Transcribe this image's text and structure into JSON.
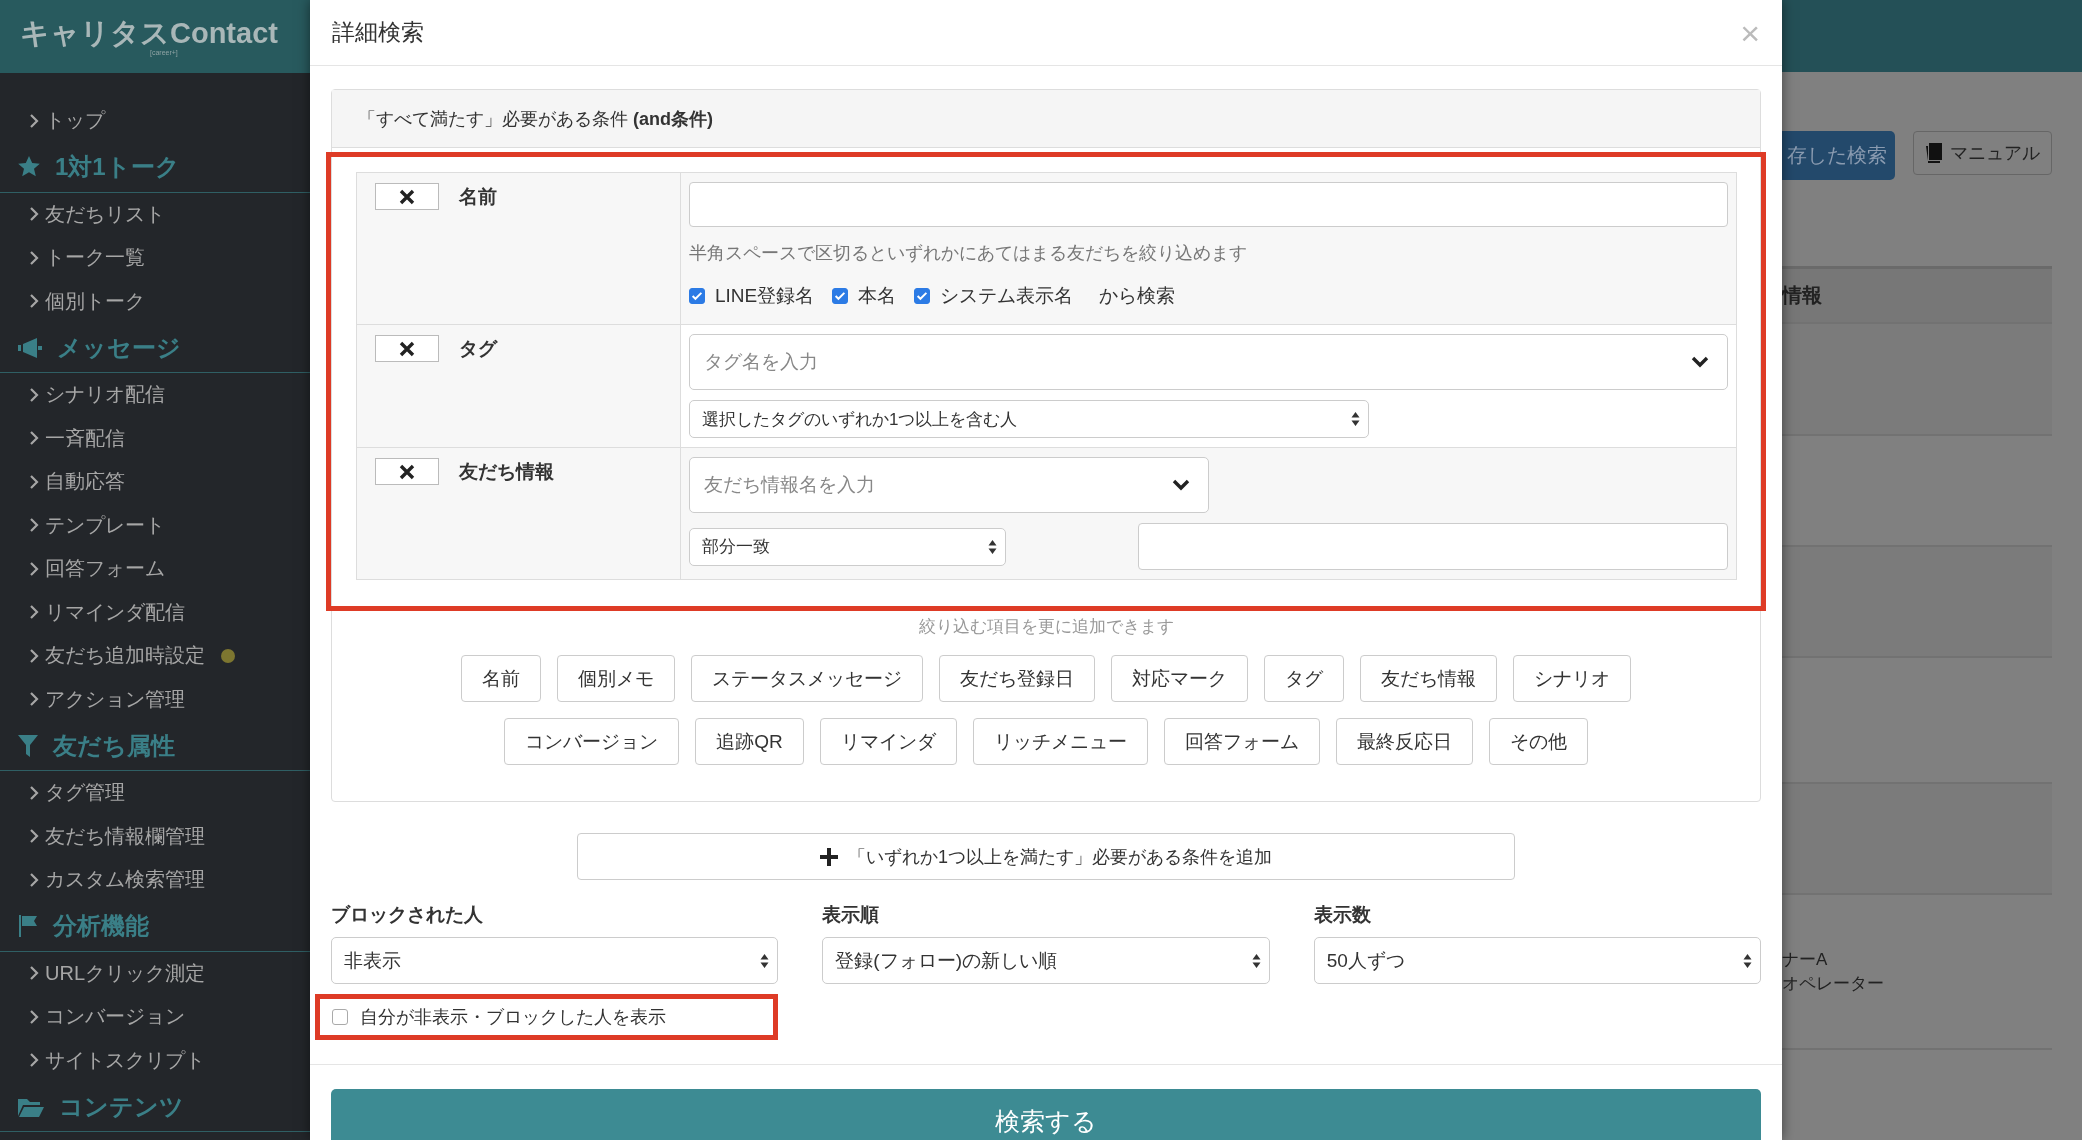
{
  "sidebar": {
    "logo": "キャリタスContact",
    "logo_sub": "[career+]",
    "top_items": [
      {
        "label": "トップ",
        "notice": false
      }
    ],
    "sections": [
      {
        "title": "1対1トーク",
        "items": [
          {
            "label": "友だちリスト",
            "notice": false
          },
          {
            "label": "トーク一覧",
            "notice": false
          },
          {
            "label": "個別トーク",
            "notice": false
          }
        ]
      },
      {
        "title": "メッセージ",
        "items": [
          {
            "label": "シナリオ配信",
            "notice": false
          },
          {
            "label": "一斉配信",
            "notice": false
          },
          {
            "label": "自動応答",
            "notice": false
          },
          {
            "label": "テンプレート",
            "notice": false
          },
          {
            "label": "回答フォーム",
            "notice": false
          },
          {
            "label": "リマインダ配信",
            "notice": false
          },
          {
            "label": "友だち追加時設定",
            "notice": true
          },
          {
            "label": "アクション管理",
            "notice": false
          }
        ]
      },
      {
        "title": "友だち属性",
        "items": [
          {
            "label": "タグ管理",
            "notice": false
          },
          {
            "label": "友だち情報欄管理",
            "notice": false
          },
          {
            "label": "カスタム検索管理",
            "notice": false
          }
        ]
      },
      {
        "title": "分析機能",
        "items": [
          {
            "label": "URLクリック測定",
            "notice": false
          },
          {
            "label": "コンバージョン",
            "notice": false
          },
          {
            "label": "サイトスクリプト",
            "notice": false
          }
        ]
      },
      {
        "title": "コンテンツ"
      }
    ]
  },
  "background": {
    "saved_search": "存した検索",
    "manual": "マニュアル",
    "table_header": "情報",
    "cell_lines": [
      "ナーA",
      "オペレーター"
    ]
  },
  "modal": {
    "title": "詳細検索",
    "close": "×",
    "and_panel": {
      "title": "「すべて満たす」必要がある条件 **(and条件)**",
      "conditions": [
        {
          "kind": "name",
          "label": "名前",
          "hint": "半角スペースで区切るといずれかにあてはまる友だちを絞り込めます",
          "options": [
            {
              "label": "LINE登録名",
              "checked": true
            },
            {
              "label": "本名",
              "checked": true
            },
            {
              "label": "システム表示名",
              "checked": true
            }
          ],
          "suffix": "から検索"
        },
        {
          "kind": "tag",
          "label": "タグ",
          "placeholder": "タグ名を入力",
          "match": "選択したタグのいずれか1つ以上を含む人"
        },
        {
          "kind": "info",
          "label": "友だち情報",
          "placeholder": "友だち情報名を入力",
          "match": "部分一致"
        }
      ],
      "add_hint": "絞り込む項目を更に追加できます",
      "add_buttons": [
        [
          "名前",
          "個別メモ",
          "ステータスメッセージ",
          "友だち登録日",
          "対応マーク",
          "タグ",
          "友だち情報",
          "シナリオ"
        ],
        [
          "コンバージョン",
          "追跡QR",
          "リマインダ",
          "リッチメニュー",
          "回答フォーム",
          "最終反応日",
          "その他"
        ]
      ]
    },
    "or_button": "「いずれか1つ以上を満たす」必要がある条件を追加",
    "filters": [
      {
        "label": "ブロックされた人",
        "value": "非表示"
      },
      {
        "label": "表示順",
        "value": "登録(フォロー)の新しい順"
      },
      {
        "label": "表示数",
        "value": "50人ずつ"
      }
    ],
    "show_hidden": {
      "label": "自分が非表示・ブロックした人を表示",
      "checked": false
    },
    "submit": "検索する"
  }
}
